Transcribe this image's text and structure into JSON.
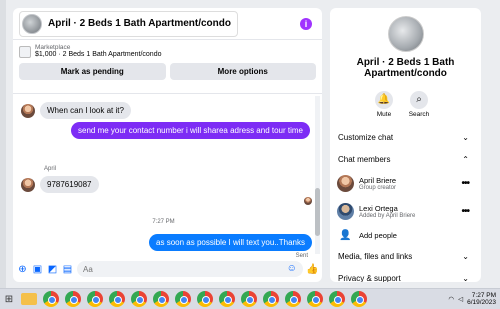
{
  "header": {
    "title": "April · 2 Beds 1 Bath Apartment/condo",
    "info_icon": "info-icon"
  },
  "listing": {
    "category": "Marketplace",
    "price_title": "$1,000 · 2 Beds 1 Bath Apartment/condo",
    "pending_label": "Mark as pending",
    "more_label": "More options"
  },
  "messages": {
    "m1": "When can I look at it?",
    "m2": "send me your contact number i will sharea adress and tour time",
    "sender_name": "April",
    "m3": "9787619087",
    "timestamp": "7:27 PM",
    "m4": "as soon as possible I will text you..Thanks",
    "status": "Sent"
  },
  "composer": {
    "placeholder": "Aa"
  },
  "side": {
    "title": "April · 2 Beds 1 Bath Apartment/condo",
    "mute_label": "Mute",
    "search_label": "Search",
    "customize": "Customize chat",
    "members_heading": "Chat members",
    "members": [
      {
        "name": "April Briere",
        "role": "Group creator"
      },
      {
        "name": "Lexi Ortega",
        "role": "Added by April Briere"
      }
    ],
    "add_people": "Add people",
    "media": "Media, files and links",
    "privacy": "Privacy & support"
  },
  "taskbar": {
    "time": "7:27 PM",
    "date": "6/19/2023"
  },
  "colors": {
    "sent_purple": "#7d2cf5",
    "sent_blue": "#0a7cff",
    "accent": "#0866ff"
  }
}
